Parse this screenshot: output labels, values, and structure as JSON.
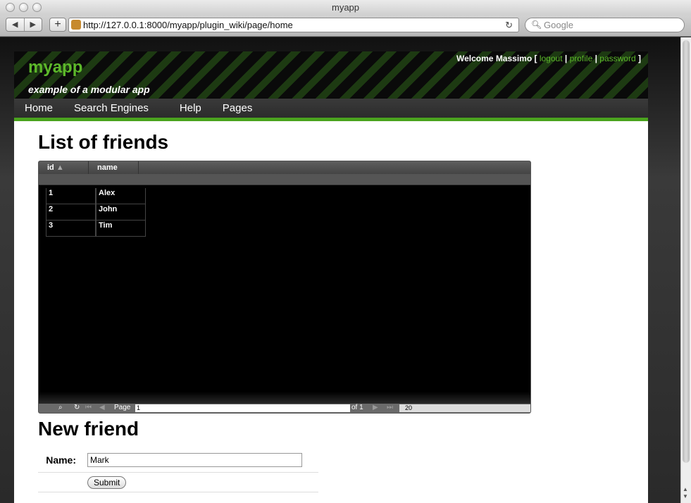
{
  "window": {
    "title": "myapp"
  },
  "toolbar": {
    "back_icon": "back-arrow-icon",
    "forward_icon": "forward-arrow-icon",
    "add_label": "+",
    "url": "http://127.0.0.1:8000/myapp/plugin_wiki/page/home",
    "reload_glyph": "↻",
    "search_placeholder": "Google"
  },
  "header": {
    "logo": "myapp",
    "tagline": "example of a modular app",
    "welcome": "Welcome Massimo",
    "links": [
      "logout",
      "profile",
      "password"
    ]
  },
  "menu": {
    "items": [
      "Home",
      "Search Engines",
      "Help",
      "Pages"
    ]
  },
  "friends": {
    "title": "List of friends",
    "columns": [
      "id",
      "name"
    ],
    "rows": [
      {
        "id": "1",
        "name": "Alex"
      },
      {
        "id": "2",
        "name": "John"
      },
      {
        "id": "3",
        "name": "Tim"
      }
    ],
    "pager": {
      "page_label": "Page",
      "page_value": "1",
      "of_label": "of 1",
      "page_size": "20"
    }
  },
  "new_friend": {
    "title": "New friend",
    "name_label": "Name:",
    "name_value": "Mark",
    "submit_label": "Submit"
  },
  "colors": {
    "accent": "#5cb82a",
    "menu_bar": "#333333",
    "grid_bg": "#000000"
  }
}
